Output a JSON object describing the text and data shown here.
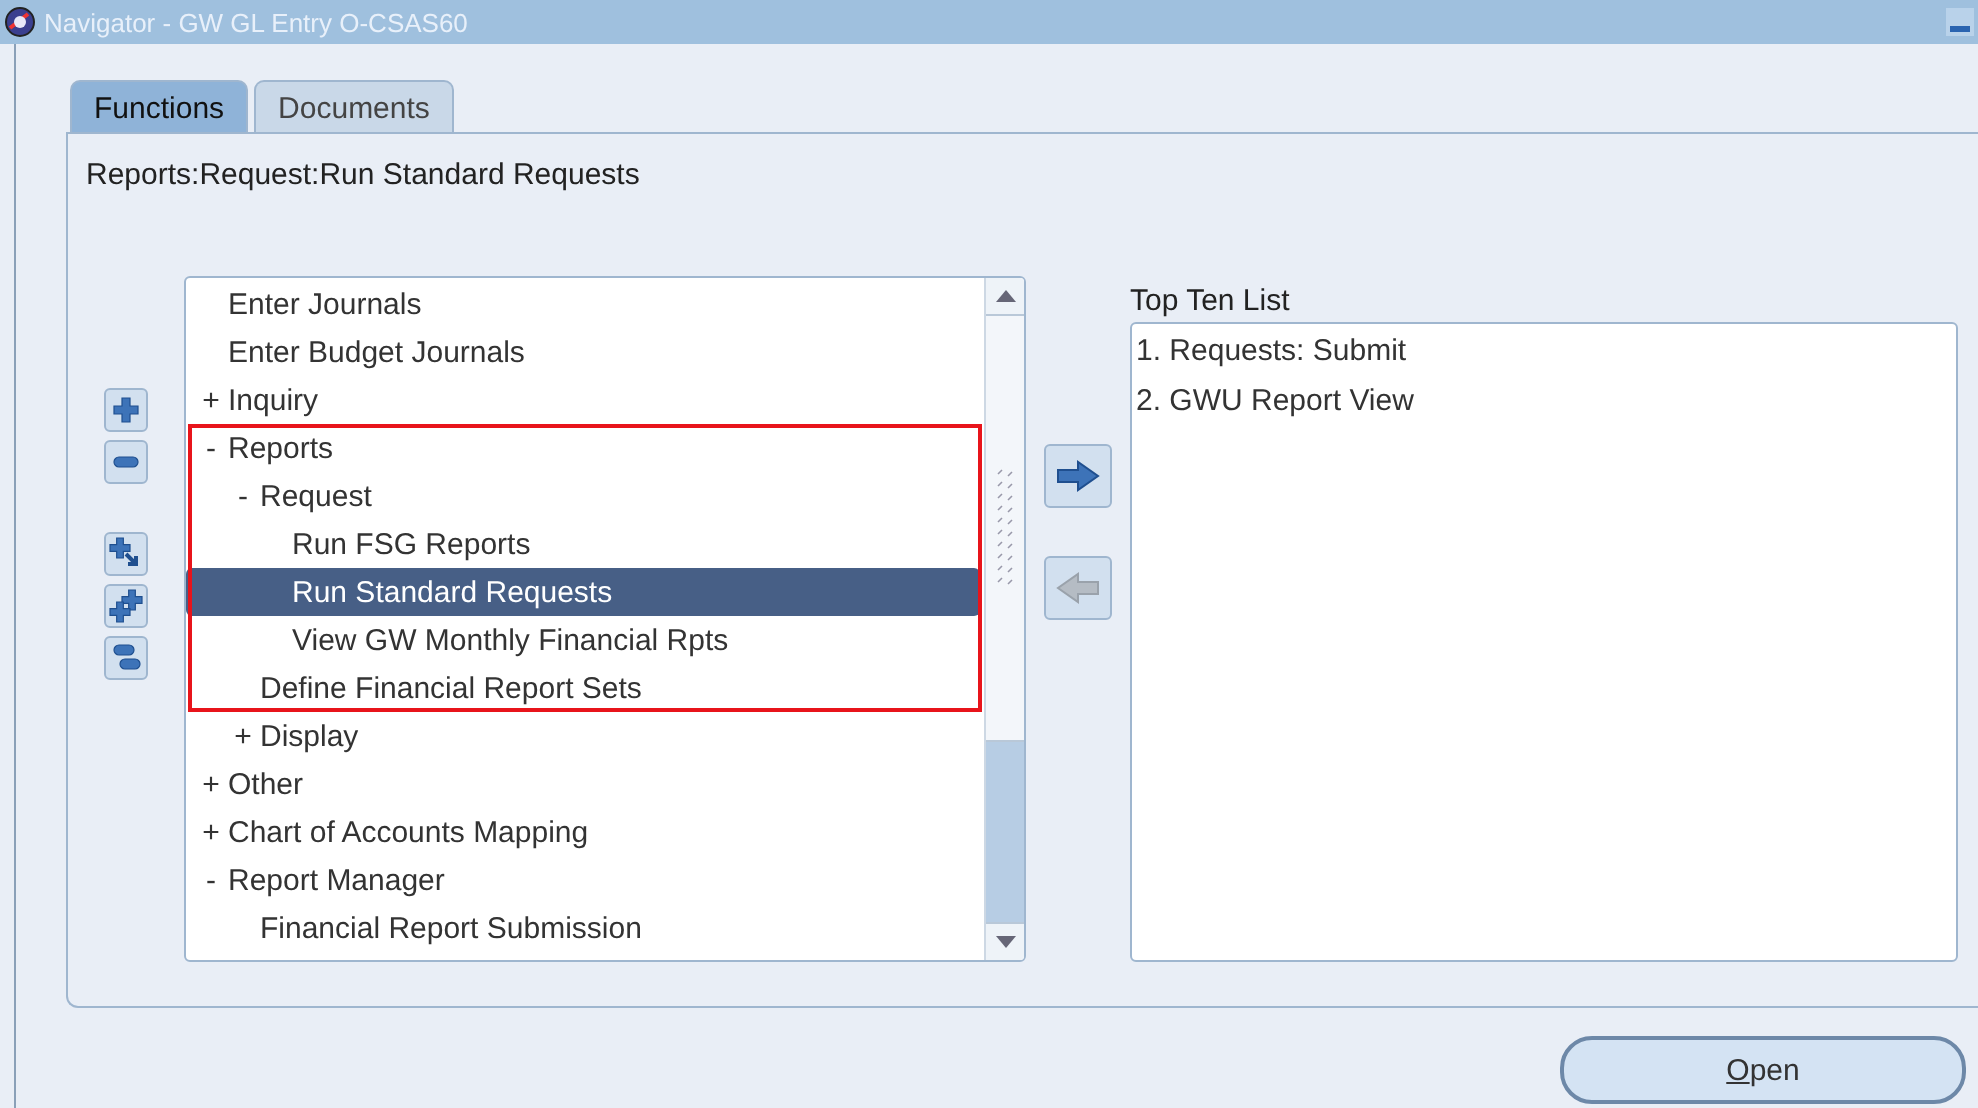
{
  "window": {
    "title": "Navigator - GW GL Entry O-CSAS60"
  },
  "tabs": [
    {
      "label": "Functions",
      "selected": true
    },
    {
      "label": "Documents",
      "selected": false
    }
  ],
  "breadcrumb": "Reports:Request:Run Standard Requests",
  "tree_tools": [
    {
      "kind": "expand"
    },
    {
      "kind": "collapse"
    },
    {
      "kind": "expand_branch"
    },
    {
      "kind": "expand_all"
    },
    {
      "kind": "collapse_all"
    }
  ],
  "tree": [
    {
      "label": "Enter Journals",
      "selected": false,
      "outlined": false
    },
    {
      "label": "Enter Budget Journals",
      "selected": false,
      "outlined": false
    },
    {
      "marker": "+",
      "label": "Inquiry",
      "selected": false,
      "outlined": false
    },
    {
      "marker": "-",
      "label": "Reports",
      "selected": false,
      "outlined": true,
      "children": [
        {
          "marker": "-",
          "label": "Request",
          "selected": false,
          "outlined": true,
          "children": [
            {
              "label": "Run FSG Reports",
              "selected": false,
              "outlined": true
            },
            {
              "label": "Run Standard Requests",
              "selected": true,
              "outlined": true
            },
            {
              "label": "View GW Monthly Financial Rpts",
              "selected": false,
              "outlined": true
            }
          ]
        },
        {
          "label": "Define Financial Report Sets",
          "selected": false,
          "outlined": true
        },
        {
          "marker": "+",
          "label": "Display",
          "selected": false,
          "outlined": false
        }
      ]
    },
    {
      "marker": "+",
      "label": "Other",
      "selected": false,
      "outlined": false
    },
    {
      "marker": "+",
      "label": "Chart of Accounts Mapping",
      "selected": false,
      "outlined": false
    },
    {
      "marker": "-",
      "label": "Report Manager",
      "selected": false,
      "outlined": false,
      "children": [
        {
          "label": "Financial Report Submission",
          "selected": false,
          "outlined": false
        }
      ]
    }
  ],
  "transfer_buttons": [
    {
      "kind": "add",
      "disabled": false
    },
    {
      "kind": "remove",
      "disabled": true
    }
  ],
  "top_ten": {
    "label": "Top Ten List",
    "items": [
      "1. Requests: Submit",
      "2. GWU Report View"
    ]
  },
  "open_button": "Open"
}
